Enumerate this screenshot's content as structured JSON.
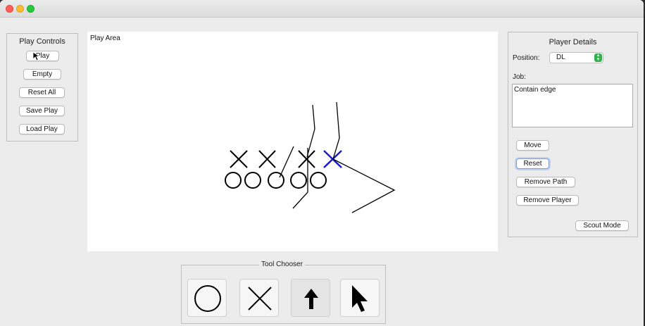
{
  "play_controls": {
    "title": "Play Controls",
    "buttons": [
      "Play",
      "Empty",
      "Reset All",
      "Save Play",
      "Load Play"
    ]
  },
  "play_area": {
    "label": "Play Area"
  },
  "player_details": {
    "title": "Player Details",
    "position_label": "Position:",
    "position_value": "DL",
    "job_label": "Job:",
    "job_value": "Contain edge",
    "buttons": [
      "Move",
      "Reset",
      "Remove Path",
      "Remove Player"
    ],
    "scout_mode": "Scout Mode"
  },
  "tool_chooser": {
    "title": "Tool Chooser",
    "tools": [
      "circle-tool",
      "x-tool",
      "arrow-tool",
      "pointer-tool"
    ]
  },
  "colors": {
    "selected_player": "#1c1cc8",
    "accent_green": "#30b14a"
  }
}
